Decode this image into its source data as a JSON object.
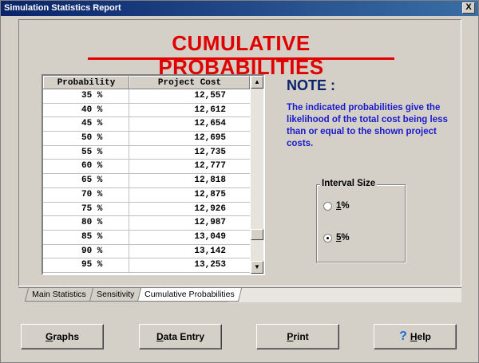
{
  "window": {
    "title": "Simulation Statistics Report",
    "close_label": "X"
  },
  "heading": "CUMULATIVE  PROBABILITIES",
  "table": {
    "headers": [
      "Probability",
      "Project Cost"
    ],
    "rows": [
      {
        "p": "35 %",
        "cost": "12,557"
      },
      {
        "p": "40 %",
        "cost": "12,612"
      },
      {
        "p": "45 %",
        "cost": "12,654"
      },
      {
        "p": "50 %",
        "cost": "12,695"
      },
      {
        "p": "55 %",
        "cost": "12,735"
      },
      {
        "p": "60 %",
        "cost": "12,777"
      },
      {
        "p": "65 %",
        "cost": "12,818"
      },
      {
        "p": "70 %",
        "cost": "12,875"
      },
      {
        "p": "75 %",
        "cost": "12,926"
      },
      {
        "p": "80 %",
        "cost": "12,987"
      },
      {
        "p": "85 %",
        "cost": "13,049"
      },
      {
        "p": "90 %",
        "cost": "13,142"
      },
      {
        "p": "95 %",
        "cost": "13,253"
      }
    ]
  },
  "note": {
    "title": "NOTE :",
    "text": "The indicated probabilities give the likelihood of the total cost being less than or equal to the shown project costs."
  },
  "interval": {
    "title": "Interval Size",
    "options": [
      {
        "accel": "1",
        "rest": " %",
        "checked": false
      },
      {
        "accel": "5",
        "rest": " %",
        "checked": true
      }
    ]
  },
  "tabs": [
    "Main Statistics",
    "Sensitivity",
    "Cumulative Probabilities"
  ],
  "buttons": {
    "graphs": {
      "accel": "G",
      "rest": "raphs"
    },
    "data_entry": {
      "accel": "D",
      "rest": "ata Entry"
    },
    "print": {
      "accel": "P",
      "rest": "rint"
    },
    "help": {
      "accel": "H",
      "rest": "elp",
      "icon": "?"
    }
  },
  "colors": {
    "heading": "#e00000",
    "note_title": "#0a246a",
    "note_text": "#1a1acc",
    "titlebar": "#0a246a"
  }
}
